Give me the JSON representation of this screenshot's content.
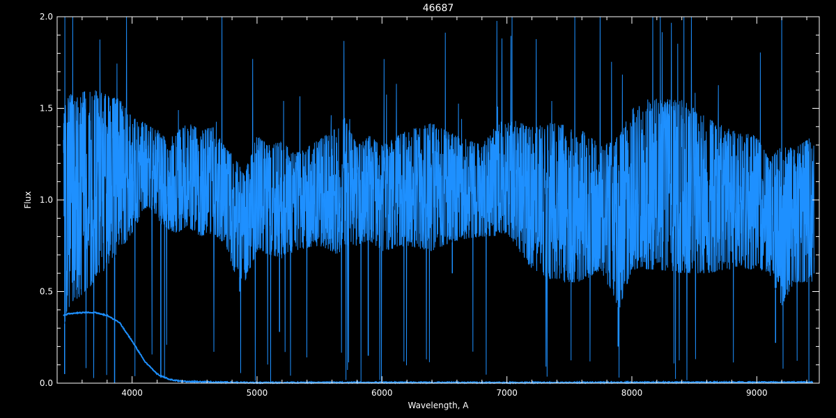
{
  "chart_data": {
    "type": "line",
    "title": "46687",
    "xlabel": "Wavelength, A",
    "ylabel": "Flux",
    "xlim": [
      3400,
      9500
    ],
    "ylim": [
      0,
      2
    ],
    "grid": false,
    "background_color": "#000000",
    "axes_color": "#ffffff",
    "x_major_ticks": [
      4000,
      5000,
      6000,
      7000,
      8000,
      9000
    ],
    "x_tick_labels": [
      "4000",
      "5000",
      "6000",
      "7000",
      "8000",
      "9000"
    ],
    "y_major_ticks": [
      0.0,
      0.5,
      1.0,
      1.5,
      2.0
    ],
    "y_tick_labels": [
      "0.0",
      "0.5",
      "1.0",
      "1.5",
      "2.0"
    ],
    "series": [
      {
        "id": "normalized",
        "color": "#1e90ff",
        "style": "noisy-spectrum",
        "envelope": {
          "x": [
            3450,
            3500,
            3700,
            3900,
            4000,
            4100,
            4150,
            4250,
            4350,
            4450,
            4550,
            4650,
            4750,
            4800,
            4900,
            5000,
            5100,
            5200,
            5300,
            5500,
            5650,
            5700,
            5800,
            5900,
            6000,
            6200,
            6400,
            6600,
            6800,
            6900,
            7000,
            7200,
            7400,
            7600,
            7750,
            7900,
            8000,
            8200,
            8400,
            8600,
            8800,
            9000,
            9100,
            9200,
            9300,
            9450
          ],
          "upper": [
            1.5,
            1.58,
            1.6,
            1.55,
            1.45,
            1.42,
            1.4,
            1.35,
            1.37,
            1.42,
            1.38,
            1.4,
            1.28,
            1.25,
            1.15,
            1.35,
            1.3,
            1.32,
            1.25,
            1.33,
            1.4,
            1.45,
            1.3,
            1.35,
            1.3,
            1.38,
            1.42,
            1.35,
            1.3,
            1.4,
            1.45,
            1.4,
            1.42,
            1.38,
            1.3,
            1.35,
            1.5,
            1.55,
            1.55,
            1.45,
            1.38,
            1.35,
            1.22,
            1.3,
            1.28,
            1.35
          ],
          "lower": [
            0.3,
            0.42,
            0.55,
            0.72,
            0.82,
            0.95,
            0.95,
            0.85,
            0.82,
            0.85,
            0.8,
            0.82,
            0.75,
            0.62,
            0.55,
            0.72,
            0.7,
            0.68,
            0.72,
            0.75,
            0.7,
            0.75,
            0.75,
            0.78,
            0.72,
            0.75,
            0.72,
            0.78,
            0.8,
            0.8,
            0.82,
            0.62,
            0.55,
            0.55,
            0.62,
            0.4,
            0.62,
            0.62,
            0.6,
            0.6,
            0.62,
            0.62,
            0.6,
            0.42,
            0.55,
            0.55
          ]
        },
        "notable_dips": [
          {
            "x": 3460,
            "y": 0.05
          },
          {
            "x": 3860,
            "y": 0.0
          },
          {
            "x": 4230,
            "y": 0.03
          },
          {
            "x": 4861,
            "y": 0.5
          },
          {
            "x": 5180,
            "y": 0.28
          },
          {
            "x": 5890,
            "y": 0.15
          },
          {
            "x": 6563,
            "y": 0.6
          },
          {
            "x": 7890,
            "y": 0.2
          },
          {
            "x": 9150,
            "y": 0.22
          }
        ]
      },
      {
        "id": "flux-continuum",
        "color": "#1e90ff",
        "style": "smooth-line",
        "x": [
          3450,
          3500,
          3600,
          3700,
          3800,
          3900,
          4000,
          4100,
          4200,
          4300,
          4400,
          4500,
          4700,
          5000,
          6000,
          7000,
          8000,
          9000,
          9450
        ],
        "y": [
          0.37,
          0.38,
          0.385,
          0.385,
          0.37,
          0.33,
          0.23,
          0.12,
          0.05,
          0.02,
          0.01,
          0.008,
          0.005,
          0.003,
          0.004,
          0.003,
          0.004,
          0.005,
          0.005
        ]
      }
    ]
  }
}
